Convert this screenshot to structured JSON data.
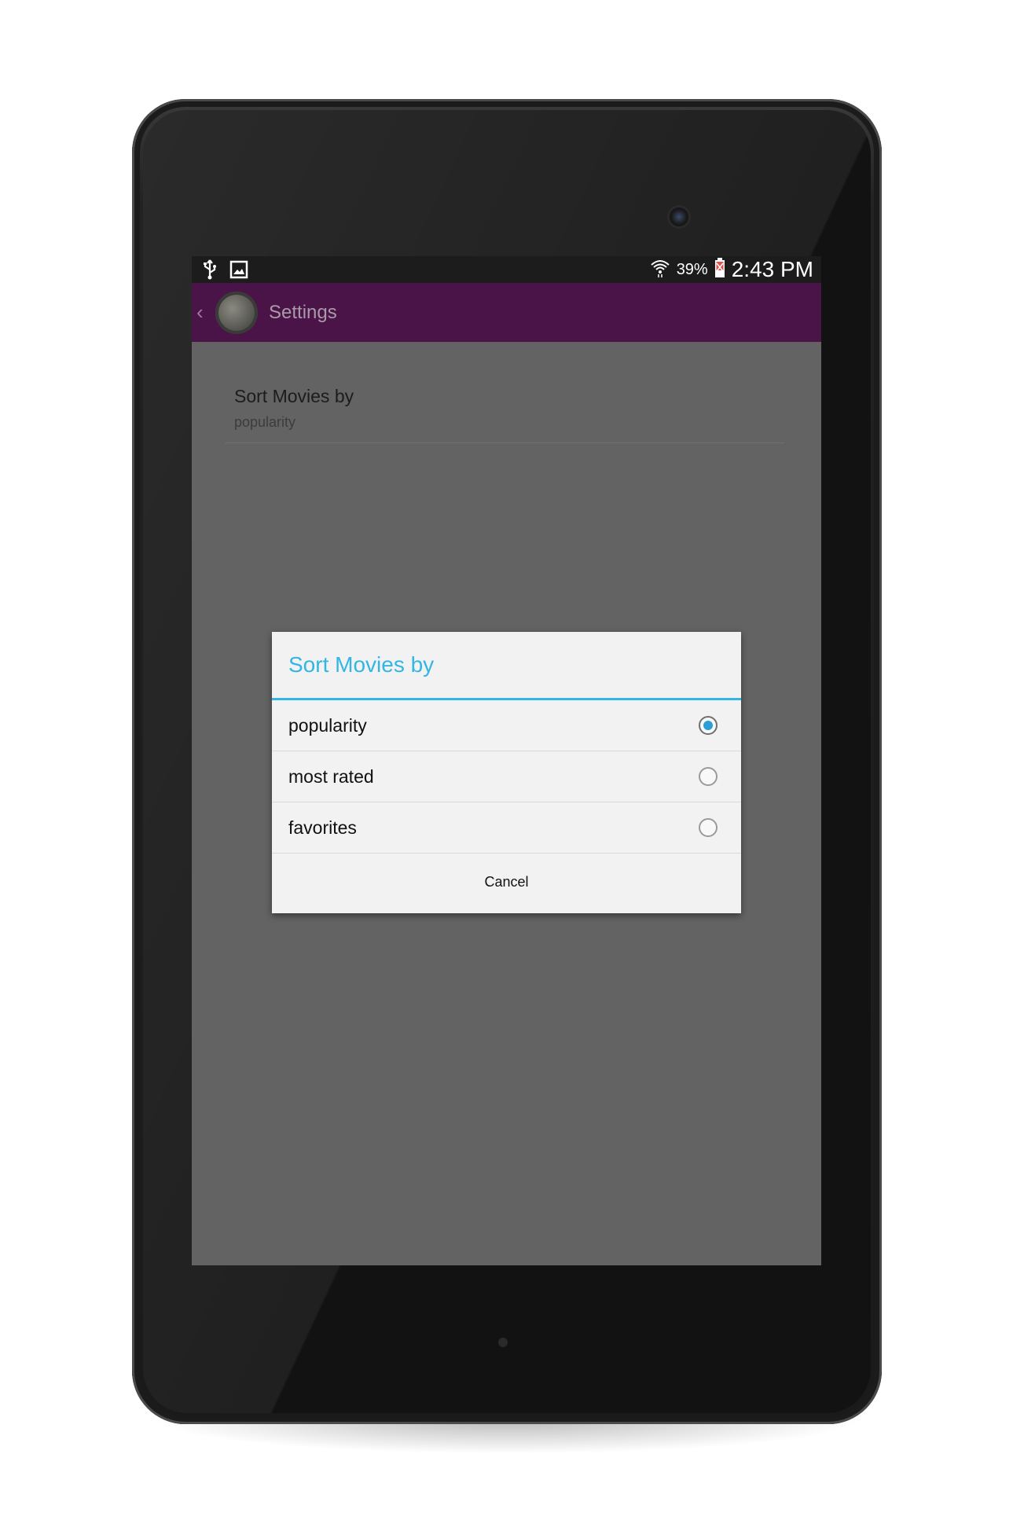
{
  "status_bar": {
    "battery": "39%",
    "clock": "2:43 PM",
    "icons": [
      "usb-icon",
      "image-icon",
      "wifi-icon",
      "battery-icon"
    ]
  },
  "action_bar": {
    "title": "Settings",
    "color": "#4a1448"
  },
  "preference": {
    "title": "Sort Movies by",
    "summary": "popularity"
  },
  "dialog": {
    "title": "Sort Movies by",
    "accent": "#33b5e5",
    "options": [
      {
        "label": "popularity",
        "checked": true
      },
      {
        "label": "most rated",
        "checked": false
      },
      {
        "label": "favorites",
        "checked": false
      }
    ],
    "cancel_label": "Cancel"
  }
}
